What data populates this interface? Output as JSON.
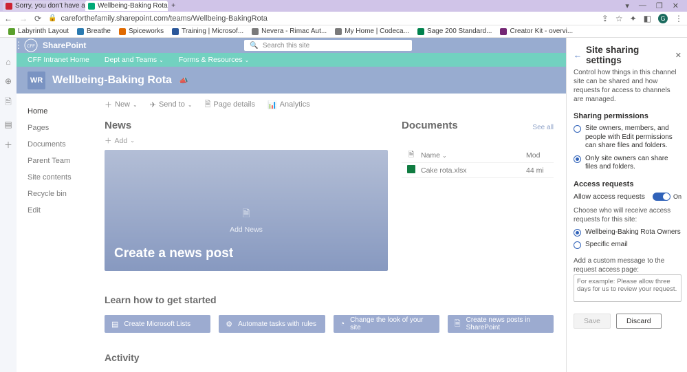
{
  "browser": {
    "tabs": [
      {
        "title": "Sorry, you don't have access v..",
        "active": false
      },
      {
        "title": "Wellbeing-Baking Rota - Home",
        "active": true
      }
    ],
    "url": "careforthefamily.sharepoint.com/teams/Wellbeing-BakingRota",
    "bookmarks": [
      {
        "label": "Labyrinth Layout",
        "color": "#5aa02c"
      },
      {
        "label": "Breathe",
        "color": "#2a7ab0"
      },
      {
        "label": "Spiceworks",
        "color": "#e06a00"
      },
      {
        "label": "Training | Microsof...",
        "color": "#2b579a"
      },
      {
        "label": "Nevera - Rimac Aut...",
        "color": "#7a7a7a"
      },
      {
        "label": "My Home | Codeca...",
        "color": "#7a7a7a"
      },
      {
        "label": "Sage 200 Standard...",
        "color": "#00824d"
      },
      {
        "label": "Creator Kit - overvi...",
        "color": "#742774"
      }
    ],
    "avatar_initial": "G"
  },
  "suite": {
    "product": "SharePoint",
    "search_placeholder": "Search this site"
  },
  "hubnav": {
    "items": [
      {
        "label": "CFF Intranet Home",
        "chevron": false
      },
      {
        "label": "Dept and Teams",
        "chevron": true
      },
      {
        "label": "Forms & Resources",
        "chevron": true
      }
    ]
  },
  "site": {
    "tile": "WR",
    "title": "Wellbeing-Baking Rota"
  },
  "quicklaunch": [
    "Home",
    "Pages",
    "Documents",
    "Parent Team",
    "Site contents",
    "Recycle bin",
    "Edit"
  ],
  "cmdbar": {
    "new": "New",
    "sendto": "Send to",
    "pagedetails": "Page details",
    "analytics": "Analytics"
  },
  "news": {
    "heading": "News",
    "add": "Add",
    "hero_center": "Add News",
    "hero_title": "Create a news post"
  },
  "documents": {
    "heading": "Documents",
    "see_all": "See all",
    "col_name": "Name",
    "col_modified": "Mod",
    "rows": [
      {
        "name": "Cake rota.xlsx",
        "modified": "44 mi"
      }
    ]
  },
  "learn": {
    "heading": "Learn how to get started",
    "cards": [
      "Create Microsoft Lists",
      "Automate tasks with rules",
      "Change the look of your site",
      "Create news posts in SharePoint"
    ]
  },
  "activity": {
    "heading": "Activity"
  },
  "panel": {
    "title": "Site sharing settings",
    "description": "Control how things in this channel site can be shared and how requests for access to channels are managed.",
    "perm_heading": "Sharing permissions",
    "perm_options": [
      "Site owners, members, and people with Edit permissions can share files and folders.",
      "Only site owners can share files and folders."
    ],
    "perm_selected": 1,
    "access_heading": "Access requests",
    "allow_label": "Allow access requests",
    "toggle_on_label": "On",
    "choose_label": "Choose who will receive access requests for this site:",
    "recipient_options": [
      "Wellbeing-Baking Rota Owners",
      "Specific email"
    ],
    "recipient_selected": 0,
    "message_label": "Add a custom message to the request access page:",
    "message_placeholder": "For example: Please allow three days for us to review your request.",
    "save": "Save",
    "discard": "Discard"
  }
}
